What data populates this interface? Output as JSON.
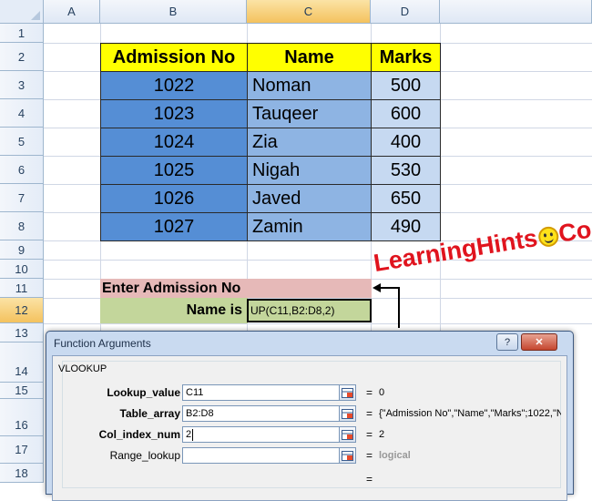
{
  "sheet": {
    "columns": [
      "A",
      "B",
      "C",
      "D"
    ],
    "rows": [
      "1",
      "2",
      "3",
      "4",
      "5",
      "6",
      "7",
      "8",
      "9",
      "10",
      "11",
      "12",
      "13",
      "14",
      "15",
      "16",
      "17",
      "18"
    ]
  },
  "table": {
    "headers": [
      "Admission No",
      "Name",
      "Marks"
    ],
    "rows": [
      {
        "admission": "1022",
        "name": "Noman",
        "marks": "500"
      },
      {
        "admission": "1023",
        "name": "Tauqeer",
        "marks": "600"
      },
      {
        "admission": "1024",
        "name": "Zia",
        "marks": "400"
      },
      {
        "admission": "1025",
        "name": "Nigah",
        "marks": "530"
      },
      {
        "admission": "1026",
        "name": "Javed",
        "marks": "650"
      },
      {
        "admission": "1027",
        "name": "Zamin",
        "marks": "490"
      }
    ]
  },
  "lookup": {
    "enter_label": "Enter Admission No",
    "name_is_label": "Name is",
    "formula_text": "UP(C11,B2:D8,2)"
  },
  "logo": {
    "left_text": "LearningHints",
    "right_text": "Com"
  },
  "dialog": {
    "title": "Function Arguments",
    "close_label": "✕",
    "function_name": "VLOOKUP",
    "args": [
      {
        "label": "Lookup_value",
        "value": "C11",
        "result": "0"
      },
      {
        "label": "Table_array",
        "value": "B2:D8",
        "result": "{\"Admission No\",\"Name\",\"Marks\";1022,\"N"
      },
      {
        "label": "Col_index_num",
        "value": "2",
        "result": "2"
      },
      {
        "label": "Range_lookup",
        "value": "",
        "result": "logical"
      }
    ],
    "equals": "="
  },
  "colors": {
    "header_yellow": "#ffff00",
    "col_b_blue": "#558ed5",
    "col_c_blue": "#8eb4e3",
    "col_d_blue": "#c6d9f1",
    "enter_pink": "#e6b9b8",
    "name_green": "#c3d69b",
    "logo_red": "#e0141e"
  }
}
